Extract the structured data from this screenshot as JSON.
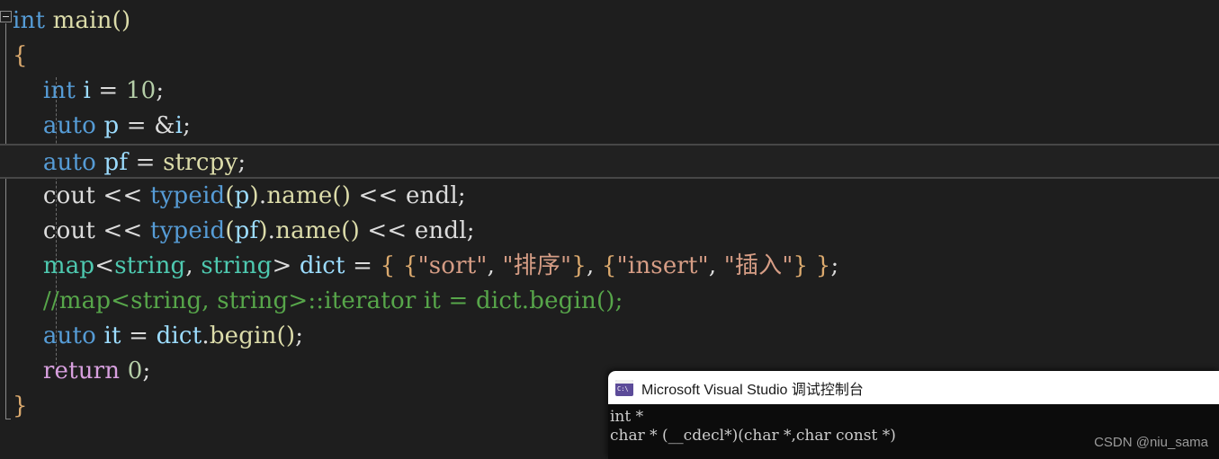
{
  "editor": {
    "background": "#1e1e1e",
    "outlining": {
      "collapse_glyph": "minus-box",
      "state": "expanded"
    },
    "current_line_index": 4,
    "lines": [
      {
        "index": 0,
        "text": "int main()"
      },
      {
        "index": 1,
        "text": "{"
      },
      {
        "index": 2,
        "text": "    int i = 10;"
      },
      {
        "index": 3,
        "text": "    auto p = &i;"
      },
      {
        "index": 4,
        "text": "    auto pf = strcpy;"
      },
      {
        "index": 5,
        "text": "    cout << typeid(p).name() << endl;"
      },
      {
        "index": 6,
        "text": "    cout << typeid(pf).name() << endl;"
      },
      {
        "index": 7,
        "text": "    map<string, string> dict = { {\"sort\", \"排序\"}, {\"insert\", \"插入\"} };"
      },
      {
        "index": 8,
        "text": "    //map<string, string>::iterator it = dict.begin();"
      },
      {
        "index": 9,
        "text": "    auto it = dict.begin();"
      },
      {
        "index": 10,
        "text": "    return 0;"
      },
      {
        "index": 11,
        "text": "}"
      }
    ],
    "tokens": {
      "l0": [
        {
          "t": "int",
          "c": "kw"
        },
        {
          "t": " ",
          "c": "plain"
        },
        {
          "t": "main",
          "c": "fn"
        },
        {
          "t": "()",
          "c": "paren"
        }
      ],
      "l1": [
        {
          "t": "{",
          "c": "brace"
        }
      ],
      "l2": [
        {
          "t": "    ",
          "c": "plain"
        },
        {
          "t": "int",
          "c": "kw"
        },
        {
          "t": " ",
          "c": "plain"
        },
        {
          "t": "i",
          "c": "var"
        },
        {
          "t": " = ",
          "c": "plain"
        },
        {
          "t": "10",
          "c": "num"
        },
        {
          "t": ";",
          "c": "plain"
        }
      ],
      "l3": [
        {
          "t": "    ",
          "c": "plain"
        },
        {
          "t": "auto",
          "c": "kw"
        },
        {
          "t": " ",
          "c": "plain"
        },
        {
          "t": "p",
          "c": "var"
        },
        {
          "t": " = &",
          "c": "plain"
        },
        {
          "t": "i",
          "c": "var"
        },
        {
          "t": ";",
          "c": "plain"
        }
      ],
      "l4": [
        {
          "t": "    ",
          "c": "plain"
        },
        {
          "t": "auto",
          "c": "kw"
        },
        {
          "t": " ",
          "c": "plain"
        },
        {
          "t": "pf",
          "c": "var"
        },
        {
          "t": " = ",
          "c": "plain"
        },
        {
          "t": "strcpy",
          "c": "fn"
        },
        {
          "t": ";",
          "c": "plain"
        }
      ],
      "l5": [
        {
          "t": "    ",
          "c": "plain"
        },
        {
          "t": "cout",
          "c": "plain"
        },
        {
          "t": " << ",
          "c": "plain"
        },
        {
          "t": "typeid",
          "c": "kw"
        },
        {
          "t": "(",
          "c": "paren"
        },
        {
          "t": "p",
          "c": "var"
        },
        {
          "t": ")",
          "c": "paren"
        },
        {
          "t": ".",
          "c": "plain"
        },
        {
          "t": "name",
          "c": "fn"
        },
        {
          "t": "()",
          "c": "paren"
        },
        {
          "t": " << ",
          "c": "plain"
        },
        {
          "t": "endl",
          "c": "plain"
        },
        {
          "t": ";",
          "c": "plain"
        }
      ],
      "l6": [
        {
          "t": "    ",
          "c": "plain"
        },
        {
          "t": "cout",
          "c": "plain"
        },
        {
          "t": " << ",
          "c": "plain"
        },
        {
          "t": "typeid",
          "c": "kw"
        },
        {
          "t": "(",
          "c": "paren"
        },
        {
          "t": "pf",
          "c": "var"
        },
        {
          "t": ")",
          "c": "paren"
        },
        {
          "t": ".",
          "c": "plain"
        },
        {
          "t": "name",
          "c": "fn"
        },
        {
          "t": "()",
          "c": "paren"
        },
        {
          "t": " << ",
          "c": "plain"
        },
        {
          "t": "endl",
          "c": "plain"
        },
        {
          "t": ";",
          "c": "plain"
        }
      ],
      "l7": [
        {
          "t": "    ",
          "c": "plain"
        },
        {
          "t": "map",
          "c": "typ"
        },
        {
          "t": "<",
          "c": "plain"
        },
        {
          "t": "string",
          "c": "typ"
        },
        {
          "t": ", ",
          "c": "plain"
        },
        {
          "t": "string",
          "c": "typ"
        },
        {
          "t": "> ",
          "c": "plain"
        },
        {
          "t": "dict",
          "c": "var"
        },
        {
          "t": " = ",
          "c": "plain"
        },
        {
          "t": "{ {",
          "c": "brace"
        },
        {
          "t": "\"sort\"",
          "c": "str"
        },
        {
          "t": ", ",
          "c": "plain"
        },
        {
          "t": "\"排序\"",
          "c": "str"
        },
        {
          "t": "}",
          "c": "brace"
        },
        {
          "t": ", ",
          "c": "plain"
        },
        {
          "t": "{",
          "c": "brace"
        },
        {
          "t": "\"insert\"",
          "c": "str"
        },
        {
          "t": ", ",
          "c": "plain"
        },
        {
          "t": "\"插入\"",
          "c": "str"
        },
        {
          "t": "} }",
          "c": "brace"
        },
        {
          "t": ";",
          "c": "plain"
        }
      ],
      "l8": [
        {
          "t": "    ",
          "c": "plain"
        },
        {
          "t": "//map<string, string>::iterator it = dict.begin();",
          "c": "cmt"
        }
      ],
      "l9": [
        {
          "t": "    ",
          "c": "plain"
        },
        {
          "t": "auto",
          "c": "kw"
        },
        {
          "t": " ",
          "c": "plain"
        },
        {
          "t": "it",
          "c": "var"
        },
        {
          "t": " = ",
          "c": "plain"
        },
        {
          "t": "dict",
          "c": "var"
        },
        {
          "t": ".",
          "c": "plain"
        },
        {
          "t": "begin",
          "c": "fn"
        },
        {
          "t": "()",
          "c": "paren"
        },
        {
          "t": ";",
          "c": "plain"
        }
      ],
      "l10": [
        {
          "t": "    ",
          "c": "plain"
        },
        {
          "t": "return",
          "c": "kw2"
        },
        {
          "t": " ",
          "c": "plain"
        },
        {
          "t": "0",
          "c": "num"
        },
        {
          "t": ";",
          "c": "plain"
        }
      ],
      "l11": [
        {
          "t": "}",
          "c": "brace"
        }
      ]
    }
  },
  "console": {
    "icon": "console-window-icon",
    "title": "Microsoft Visual Studio 调试控制台",
    "output_lines": [
      "int *",
      "char * (__cdecl*)(char *,char const *)"
    ]
  },
  "watermark": {
    "text": "CSDN @niu_sama"
  }
}
